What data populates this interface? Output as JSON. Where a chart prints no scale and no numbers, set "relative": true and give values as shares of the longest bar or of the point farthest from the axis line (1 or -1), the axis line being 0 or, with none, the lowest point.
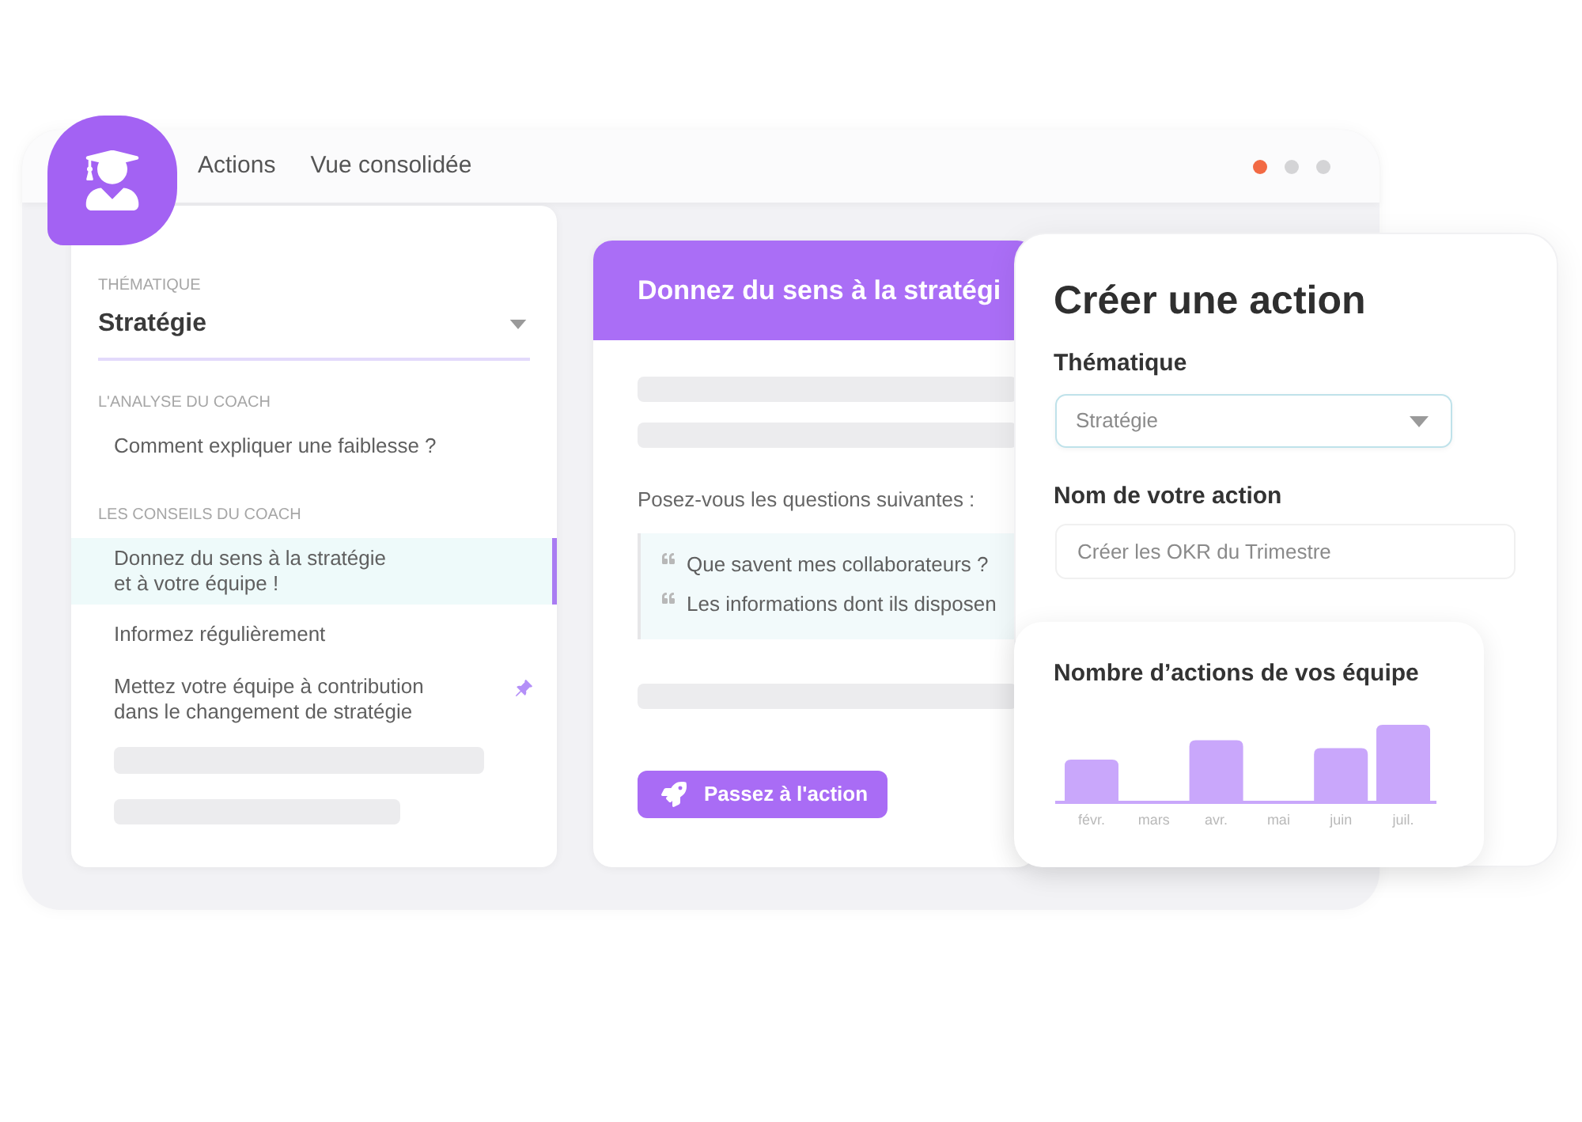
{
  "nav": [
    {
      "label": "Actions"
    },
    {
      "label": "Vue consolidée"
    }
  ],
  "sidebar": {
    "theme_label": "THÉMATIQUE",
    "theme_value": "Stratégie",
    "sections": [
      {
        "title": "L'ANALYSE DU COACH",
        "items": [
          {
            "label": "Comment expliquer une faiblesse ?",
            "selected": false,
            "pinned": false
          }
        ]
      },
      {
        "title": "LES CONSEILS DU COACH",
        "items": [
          {
            "label": "Donnez du sens à la stratégie\net à votre équipe !",
            "selected": true,
            "pinned": false
          },
          {
            "label": "Informez régulièrement",
            "selected": false,
            "pinned": false
          },
          {
            "label": "Mettez votre équipe à contribution\ndans le changement de stratégie",
            "selected": false,
            "pinned": true
          }
        ]
      }
    ]
  },
  "advice_card": {
    "title": "Donnez du sens à la stratégi",
    "prompt": "Posez-vous les questions suivantes :",
    "questions": [
      "Que savent mes collaborateurs ?",
      "Les informations dont ils disposen"
    ],
    "action_button": "Passez à l'action"
  },
  "create_action": {
    "title": "Créer une action",
    "fields": [
      {
        "kind": "select",
        "label": "Thématique",
        "value": "Stratégie"
      },
      {
        "kind": "text",
        "label": "Nom de votre action",
        "placeholder": "Créer les OKR du Trimestre"
      }
    ],
    "chart": {
      "chart_data": {
        "type": "bar",
        "title": "Nombre d’actions de vos équipe",
        "categories": [
          "févr.",
          "mars",
          "avr.",
          "mai",
          "juin",
          "juil."
        ],
        "values": [
          0.55,
          0,
          0.8,
          0,
          0.7,
          1
        ],
        "relative": true
      }
    }
  }
}
